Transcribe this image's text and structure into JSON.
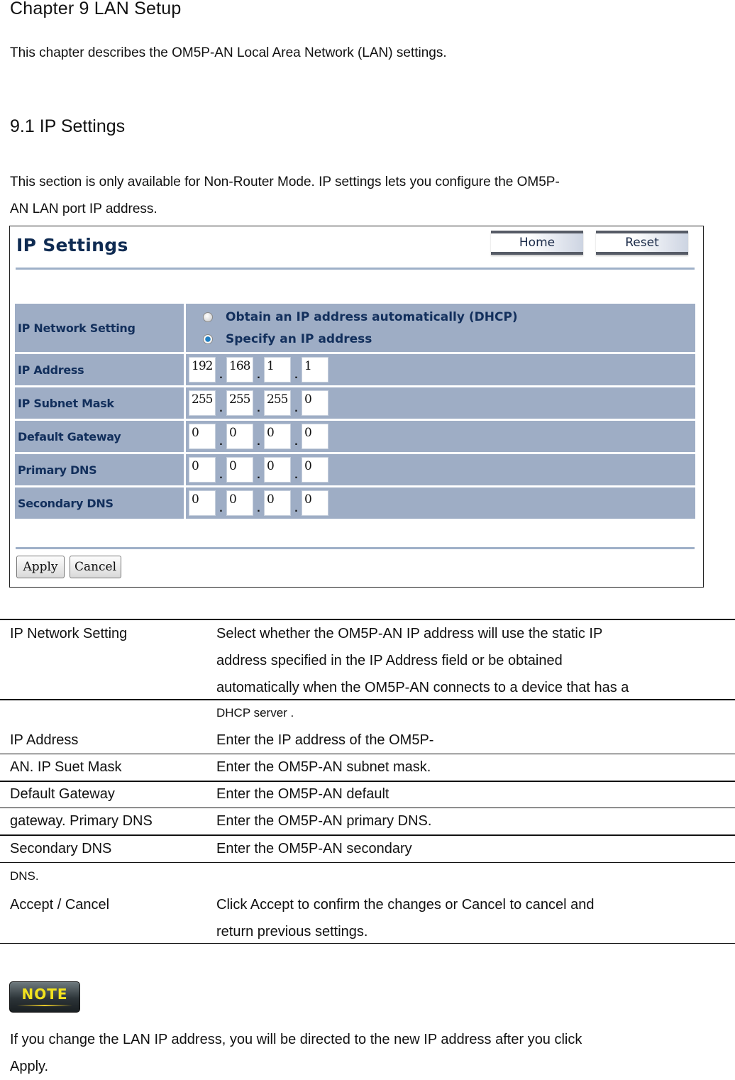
{
  "document": {
    "chapter_title": "Chapter 9 LAN Setup",
    "intro": "This chapter describes the OM5P-AN Local Area Network (LAN) settings.",
    "section_title": "9.1 IP Settings",
    "section_desc_line1": "This section is only available for Non-Router Mode. IP settings lets you configure the OM5P-",
    "section_desc_line2": "AN LAN port  IP address."
  },
  "ui": {
    "title": "IP Settings",
    "nav_buttons": {
      "home": "Home",
      "reset": "Reset"
    },
    "network_setting": {
      "label": "IP Network Setting",
      "options": [
        {
          "label": "Obtain an IP address automatically (DHCP)",
          "checked": false
        },
        {
          "label": "Specify an IP address",
          "checked": true
        }
      ]
    },
    "fields": [
      {
        "label": "IP Address",
        "octets": [
          "192",
          "168",
          "1",
          "1"
        ]
      },
      {
        "label": "IP Subnet Mask",
        "octets": [
          "255",
          "255",
          "255",
          "0"
        ]
      },
      {
        "label": "Default Gateway",
        "octets": [
          "0",
          "0",
          "0",
          "0"
        ]
      },
      {
        "label": "Primary DNS",
        "octets": [
          "0",
          "0",
          "0",
          "0"
        ]
      },
      {
        "label": "Secondary DNS",
        "octets": [
          "0",
          "0",
          "0",
          "0"
        ]
      }
    ],
    "separator": ".",
    "apply_label": "Apply",
    "cancel_label": "Cancel",
    "colors": {
      "label_bg": "#9eadc5",
      "label_text": "#122f5c",
      "rule": "#9fb0c8",
      "radio_selected": "#1f7fc3"
    }
  },
  "desc_table": {
    "rows": [
      {
        "term": "IP Network Setting",
        "lines": [
          "Select whether the OM5P-AN  IP address will use the static IP",
          "address specified in the IP Address field or be obtained",
          "automatically when the OM5P-AN connects to  a device that has a"
        ]
      },
      {
        "term": "",
        "lines": [
          "DHCP  server  ."
        ]
      },
      {
        "term": "IP Address",
        "lines": [
          "Enter the IP address  of the OM5P-"
        ]
      },
      {
        "term": "AN. IP Suet Mask",
        "lines": [
          "Enter the OM5P-AN subnet mask."
        ]
      },
      {
        "term": "Default Gateway",
        "lines": [
          "Enter the OM5P-AN default"
        ]
      },
      {
        "term": "gateway. Primary DNS",
        "lines": [
          "Enter the OM5P-AN primary DNS."
        ]
      },
      {
        "term": "Secondary DNS",
        "lines": [
          "Enter the OM5P-AN secondary"
        ]
      },
      {
        "term": "DNS.",
        "lines": []
      },
      {
        "term": "Accept / Cancel",
        "lines": [
          "Click Accept to confirm the changes or Cancel to cancel and",
          "return previous settings."
        ]
      }
    ]
  },
  "note": {
    "badge": "NOTE",
    "text_line1": "If you change the LAN IP address,  you will be directed to  the new IP address  after you click",
    "text_line2": "Apply."
  }
}
